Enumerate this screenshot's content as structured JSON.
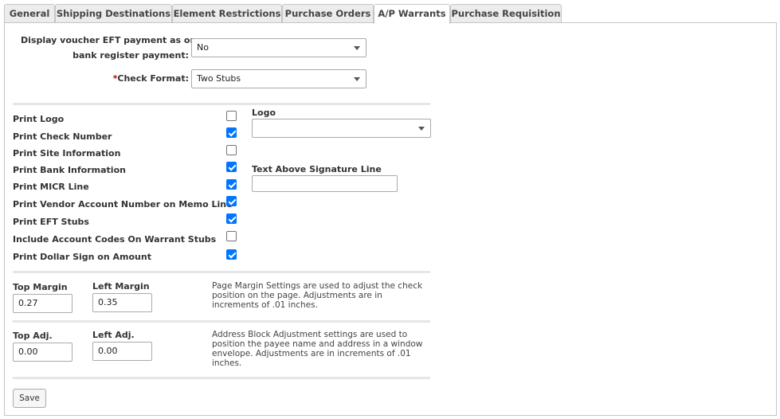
{
  "tabs": [
    {
      "label": "General"
    },
    {
      "label": "Shipping Destinations"
    },
    {
      "label": "Element Restrictions"
    },
    {
      "label": "Purchase Orders"
    },
    {
      "label": "A/P Warrants"
    },
    {
      "label": "Purchase Requisition"
    }
  ],
  "voucher_eft": {
    "label_line1": "Display voucher EFT payment as one",
    "label_line2": "bank register payment:",
    "value": "No"
  },
  "check_format": {
    "required_mark": "*",
    "label": "Check Format:",
    "value": "Two Stubs"
  },
  "print_options": [
    {
      "label": "Print Logo",
      "checked": false
    },
    {
      "label": "Print Check Number",
      "checked": true
    },
    {
      "label": "Print Site Information",
      "checked": false
    },
    {
      "label": "Print Bank Information",
      "checked": true
    },
    {
      "label": "Print MICR Line",
      "checked": true
    },
    {
      "label": "Print Vendor Account Number on Memo Line",
      "checked": true
    },
    {
      "label": "Print EFT Stubs",
      "checked": true
    },
    {
      "label": "Include Account Codes On Warrant Stubs",
      "checked": false
    },
    {
      "label": "Print Dollar Sign on Amount",
      "checked": true
    }
  ],
  "logo": {
    "label": "Logo",
    "value": ""
  },
  "signature_text": {
    "label": "Text Above Signature Line",
    "value": ""
  },
  "margins": {
    "top_label": "Top Margin",
    "top_value": "0.27",
    "left_label": "Left Margin",
    "left_value": "0.35",
    "note": "Page Margin Settings are used to adjust the check position on the page. Adjustments are in increments of .01 inches."
  },
  "adjustments": {
    "top_label": "Top Adj.",
    "top_value": "0.00",
    "left_label": "Left Adj.",
    "left_value": "0.00",
    "note": "Address Block Adjustment settings are used to position the payee name and address in a window envelope. Adjustments are in increments of .01 inches."
  },
  "save_label": "Save",
  "colors": {
    "checkbox_accent": "#0075ff"
  }
}
